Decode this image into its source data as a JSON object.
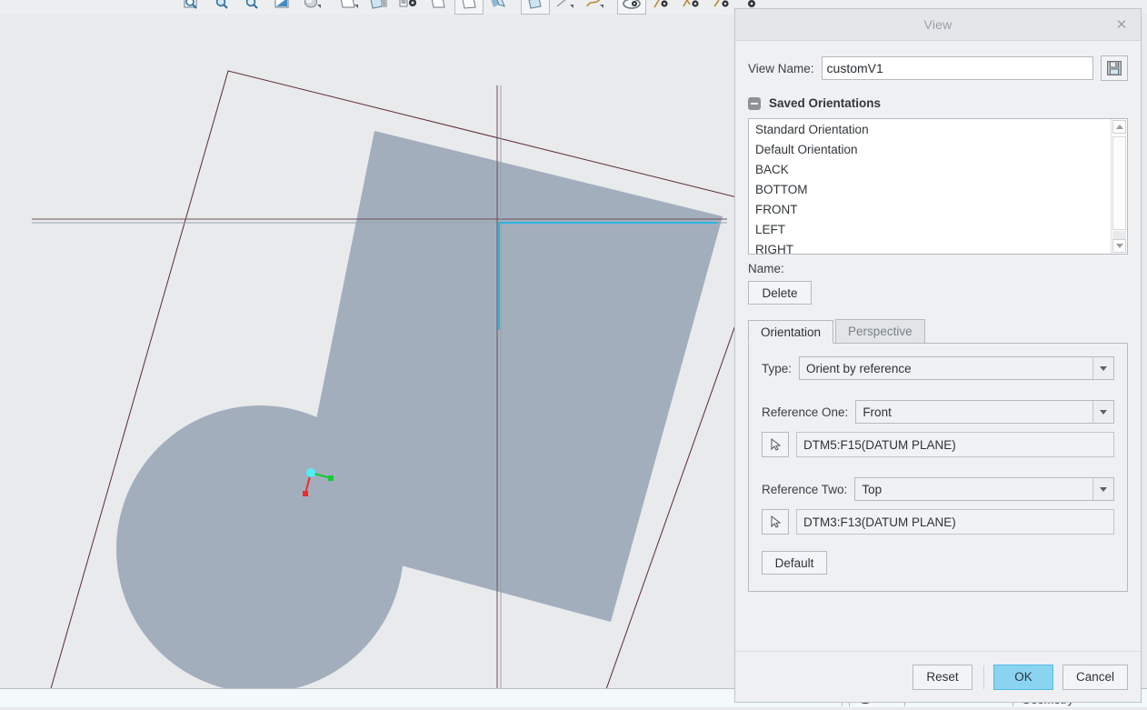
{
  "app": {
    "viewport_bg": "#e8eaec",
    "toolbar_icons": [
      "zoom-box-icon",
      "zoom-in-icon",
      "zoom-out-icon",
      "refit-icon",
      "shading-icon",
      "datum-plane-icon",
      "datum-axis-icon",
      "datum-point-icon",
      "datum-csys-icon",
      "plane-display-icon",
      "axis-display-icon",
      "point-display-icon",
      "csys-display-icon",
      "annotation-display-icon",
      "spin-center-icon",
      "layer-icon",
      "saved-view-icon",
      "view-manager-icon",
      "appearance-icon",
      "perspective-icon"
    ],
    "status_bar": {
      "geometry_label": "Geometry",
      "filter_icon": "filter-icon",
      "dropdown_icon": "chevron-down-icon"
    },
    "model": {
      "body_fill": "#a3aebd",
      "datum_plane_edge": "#5b2b32",
      "highlight_color": "#2fb4e0",
      "csys": {
        "origin_color": "#4ef0f5",
        "x_axis_color": "#16c936",
        "y_axis_color": "#ee2b2b",
        "label": "coordinate-system-triad"
      }
    }
  },
  "dialog": {
    "title": "View",
    "close_icon": "close-icon",
    "view_name": {
      "label": "View Name:",
      "value": "customV1",
      "placeholder": "",
      "save_icon": "save-floppy-icon"
    },
    "saved_orientations": {
      "title": "Saved Orientations",
      "collapse_icon": "collapse-minus-icon",
      "expanded": true,
      "items": [
        "Standard Orientation",
        "Default Orientation",
        "BACK",
        "BOTTOM",
        "FRONT",
        "LEFT",
        "RIGHT"
      ],
      "scrollbar": {
        "up_icon": "scroll-up-icon",
        "down_icon": "scroll-down-icon"
      },
      "name_label": "Name:",
      "name_value": "",
      "delete_label": "Delete"
    },
    "tabs": [
      {
        "label": "Orientation",
        "active": true
      },
      {
        "label": "Perspective",
        "active": false
      }
    ],
    "orientation_panel": {
      "type": {
        "label": "Type:",
        "value": "Orient by reference",
        "dropdown_icon": "chevron-down-icon"
      },
      "reference_one": {
        "label": "Reference One:",
        "value": "Front",
        "dropdown_icon": "chevron-down-icon",
        "pick_icon": "select-arrow-icon",
        "selection": "DTM5:F15(DATUM PLANE)"
      },
      "reference_two": {
        "label": "Reference Two:",
        "value": "Top",
        "dropdown_icon": "chevron-down-icon",
        "pick_icon": "select-arrow-icon",
        "selection": "DTM3:F13(DATUM PLANE)"
      },
      "default_label": "Default"
    },
    "footer": {
      "reset_label": "Reset",
      "ok_label": "OK",
      "cancel_label": "Cancel",
      "ok_accent": "#8ad4f2"
    }
  }
}
